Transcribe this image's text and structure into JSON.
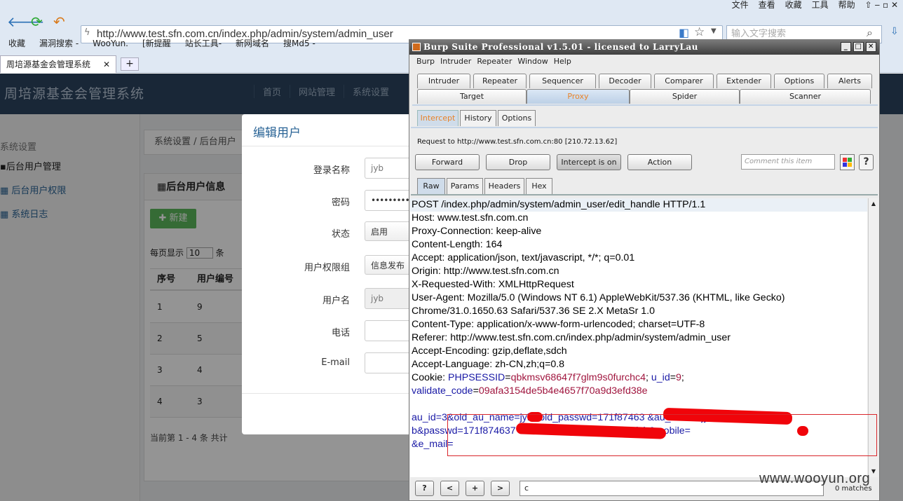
{
  "browser": {
    "top_menu": [
      "文件",
      "查看",
      "收藏",
      "工具",
      "帮助"
    ],
    "url": "http://www.test.sfn.com.cn/index.php/admin/system/admin_user",
    "search_placeholder": "输入文字搜索",
    "bookmarks": [
      "收藏",
      "漏洞搜索 -",
      "WooYun.",
      "[新提醒",
      "站长工具-",
      "新网域名",
      "搜Md5 -"
    ],
    "tab_title": "周培源基金会管理系统",
    "new_tab": "+"
  },
  "site": {
    "title": "周培源基金会管理系统",
    "nav": [
      "首页",
      "网站管理",
      "系统设置"
    ],
    "sidebar": [
      "系统设置",
      "后台用户管理",
      "后台用户权限",
      "系统日志"
    ],
    "breadcrumb": [
      "系统设置",
      "/",
      "后台用户"
    ],
    "panel_title": "后台用户信息",
    "new_button": "新建",
    "per_page_label": "每页显示",
    "per_page_value": "10",
    "per_page_suffix": "条",
    "columns": [
      "序号",
      "用户编号"
    ],
    "rows": [
      [
        "1",
        "9"
      ],
      [
        "2",
        "5"
      ],
      [
        "3",
        "4"
      ],
      [
        "4",
        "3"
      ]
    ],
    "footer_text": "当前第 1 - 4 条   共计"
  },
  "modal": {
    "title": "编辑用户",
    "fields": [
      {
        "label": "登录名称",
        "value": "jyb"
      },
      {
        "label": "密码",
        "value": "••••••••••"
      },
      {
        "label": "状态",
        "value": "启用"
      },
      {
        "label": "用户权限组",
        "value": "信息发布"
      },
      {
        "label": "用户名",
        "value": "jyb"
      },
      {
        "label": "电话",
        "value": ""
      },
      {
        "label": "E-mail",
        "value": ""
      }
    ]
  },
  "burp": {
    "title": "Burp Suite Professional v1.5.01 - licensed to LarryLau",
    "menu": [
      "Burp",
      "Intruder",
      "Repeater",
      "Window",
      "Help"
    ],
    "tabs_row1": [
      "Intruder",
      "Repeater",
      "Sequencer",
      "Decoder",
      "Comparer",
      "Extender",
      "Options",
      "Alerts"
    ],
    "tabs_row2": [
      "Target",
      "Proxy",
      "Spider",
      "Scanner"
    ],
    "selected_tab": "Proxy",
    "subtabs": [
      "Intercept",
      "History",
      "Options"
    ],
    "request_to": "Request to http://www.test.sfn.com.cn:80  [210.72.13.62]",
    "buttons": [
      "Forward",
      "Drop",
      "Intercept is on",
      "Action"
    ],
    "comment_placeholder": "Comment this item",
    "help_label": "?",
    "view_tabs": [
      "Raw",
      "Params",
      "Headers",
      "Hex"
    ],
    "request_lines": [
      "POST /index.php/admin/system/admin_user/edit_handle HTTP/1.1",
      "Host: www.test.sfn.com.cn",
      "Proxy-Connection: keep-alive",
      "Content-Length: 164",
      "Accept: application/json, text/javascript, */*; q=0.01",
      "Origin: http://www.test.sfn.com.cn",
      "X-Requested-With: XMLHttpRequest",
      "User-Agent: Mozilla/5.0 (Windows NT 6.1) AppleWebKit/537.36 (KHTML, like Gecko)",
      "Chrome/31.0.1650.63 Safari/537.36 SE 2.X MetaSr 1.0",
      "Content-Type: application/x-www-form-urlencoded; charset=UTF-8",
      "Referer: http://www.test.sfn.com.cn/index.php/admin/system/admin_user",
      "Accept-Encoding: gzip,deflate,sdch",
      "Accept-Language: zh-CN,zh;q=0.8"
    ],
    "cookie": {
      "label": "Cookie: ",
      "k1": "PHPSESSID",
      "v1": "qbkmsv68647f7glm9s0furchc4",
      "k2": "u_id",
      "v2": "9",
      "k3": "validate_code",
      "v3": "09afa3154de5b4e4657f70a9d3efd38e"
    },
    "body_lines": [
      "au_id=3&old_au_name=jyb&old_passwd=171f87463                  &au_name=jy",
      "b&passwd=171f874637                         status=0&ag_id=3&name=jyb&mobile=",
      "&e_mail="
    ],
    "search_buttons": [
      "?",
      "<",
      "+",
      ">"
    ],
    "search_value": "c",
    "matches": "0 matches"
  },
  "watermark": "www.wooyun.org",
  "colors": {
    "site_header": "#2b4460",
    "burp_selected": "#e8832a",
    "redact": "#f0040a",
    "red_box": "#d9262b"
  }
}
